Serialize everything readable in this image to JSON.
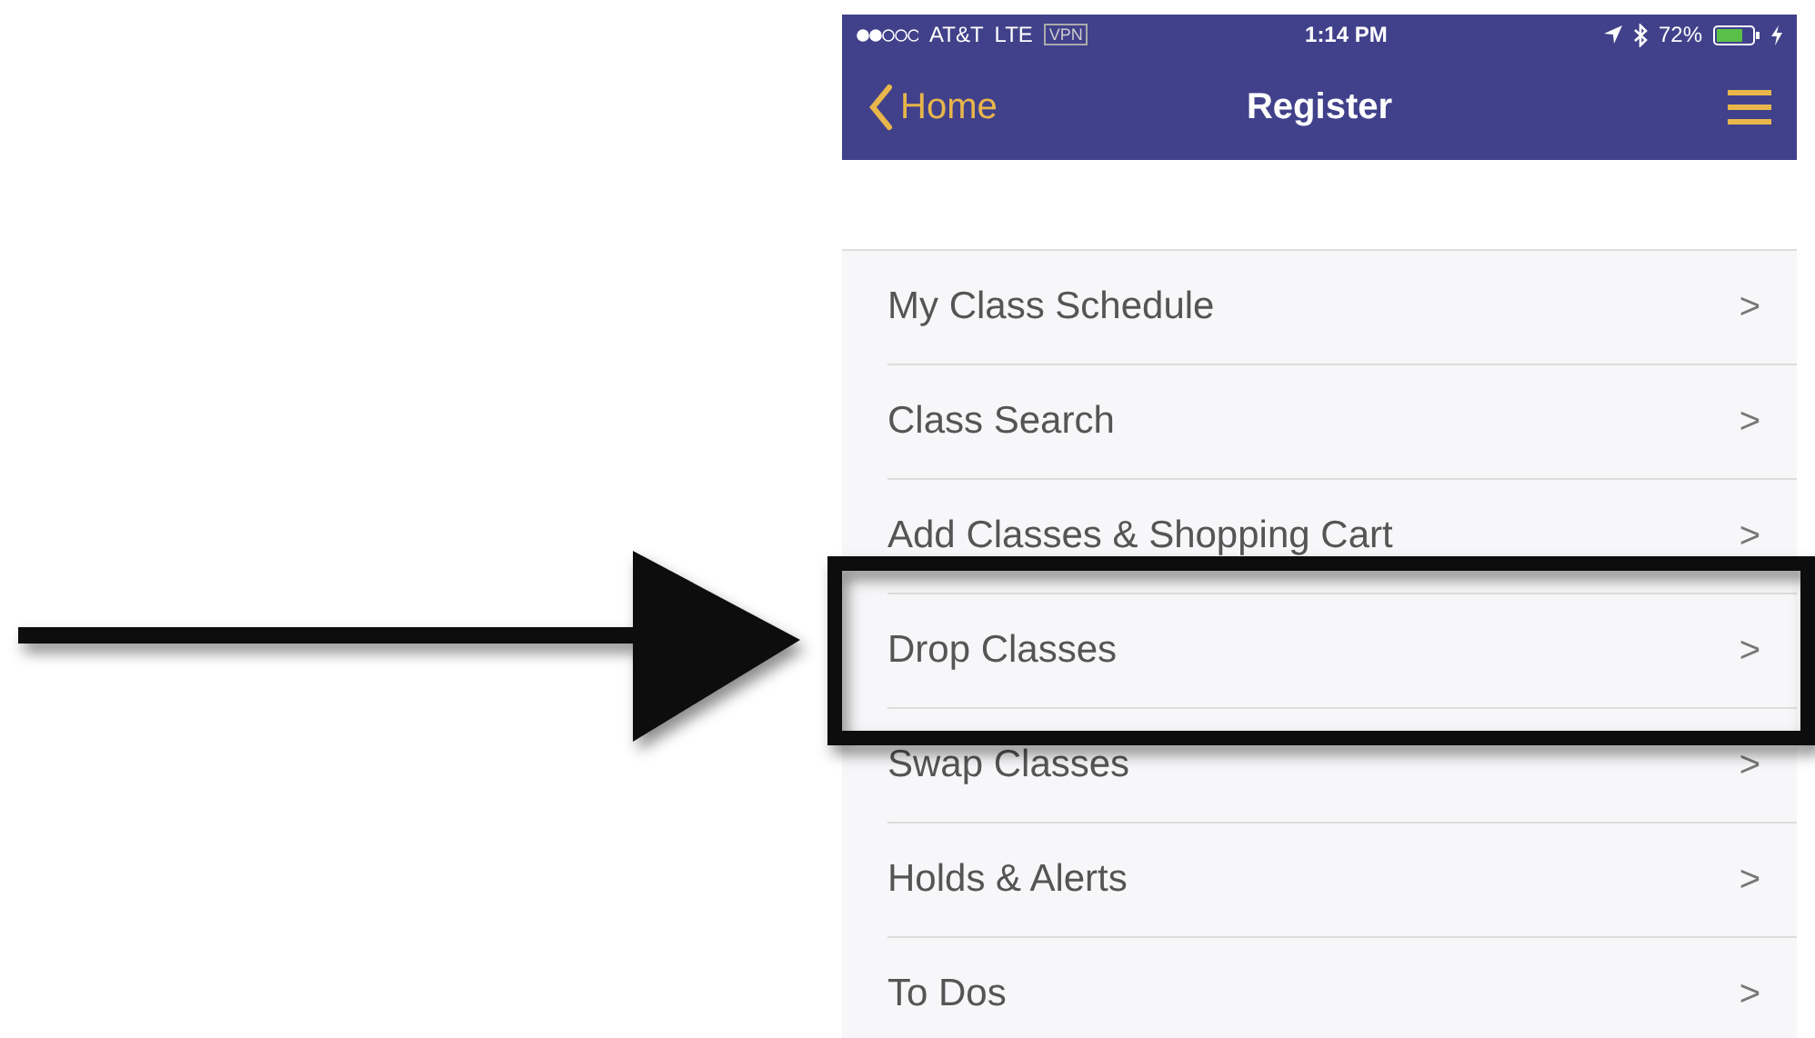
{
  "status_bar": {
    "carrier": "AT&T",
    "network": "LTE",
    "vpn": "VPN",
    "time": "1:14 PM",
    "battery": "72%"
  },
  "nav_bar": {
    "back": "Home",
    "title": "Register"
  },
  "menu": [
    {
      "label": "My Class Schedule",
      "chevron": ">"
    },
    {
      "label": "Class Search",
      "chevron": ">"
    },
    {
      "label": "Add Classes & Shopping Cart",
      "chevron": ">"
    },
    {
      "label": "Drop Classes",
      "chevron": ">"
    },
    {
      "label": "Swap Classes",
      "chevron": ">"
    },
    {
      "label": "Holds & Alerts",
      "chevron": ">"
    },
    {
      "label": "To Dos",
      "chevron": ">"
    }
  ]
}
